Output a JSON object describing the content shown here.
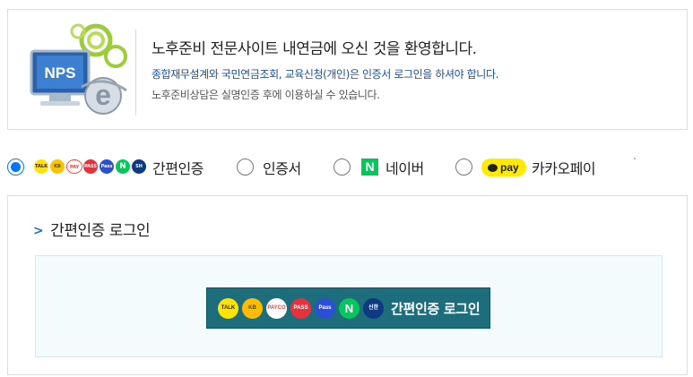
{
  "welcome": {
    "logo_text": "NPS",
    "title": "노후준비 전문사이트 내연금에 오신 것을 환영합니다.",
    "notice": "종합재무설계와 국민연금조회, 교육신청(개인)은 인증서 로그인을 하셔야 합니다.",
    "sub": "노후준비상담은 실명인증 후에 이용하실 수 있습니다."
  },
  "methods": {
    "simple": {
      "label": "간편인증",
      "selected": true
    },
    "cert": {
      "label": "인증서",
      "selected": false
    },
    "naver": {
      "label": "네이버",
      "icon_text": "N",
      "selected": false
    },
    "kakao": {
      "label": "카카오페이",
      "icon_text": "pay",
      "selected": false
    },
    "mini_icons": [
      {
        "name": "kakaotalk-icon",
        "color": "#fee500"
      },
      {
        "name": "kb-icon",
        "color": "#f9c400"
      },
      {
        "name": "payco-icon",
        "color": "#ff3c3c"
      },
      {
        "name": "pass-red-icon",
        "color": "#e8313b"
      },
      {
        "name": "pass-blue-icon",
        "color": "#2b4fd6"
      },
      {
        "name": "naver-icon",
        "color": "#03c75a"
      },
      {
        "name": "shinhan-icon",
        "color": "#0d3a80"
      }
    ],
    "tick_mark": "ˋ"
  },
  "panel": {
    "title": "간편인증 로그인",
    "button": {
      "label": "간편인증 로그인",
      "icons": [
        {
          "name": "kakaotalk-icon",
          "text": "TALK",
          "color": "#fee500",
          "text_color": "#3a1d1d"
        },
        {
          "name": "kb-icon",
          "text": "KB",
          "color": "#ffbc00",
          "text_color": "#5a4a00"
        },
        {
          "name": "payco-icon",
          "text": "PAYCO",
          "color": "#ffffff",
          "text_color": "#ff3c3c"
        },
        {
          "name": "pass-red-icon",
          "text": "PASS",
          "color": "#e8313b",
          "text_color": "#ffffff"
        },
        {
          "name": "pass-blue-icon",
          "text": "Pass",
          "color": "#2b4fd6",
          "text_color": "#ffffff"
        },
        {
          "name": "naver-icon",
          "text": "N",
          "color": "#03c75a",
          "text_color": "#ffffff"
        },
        {
          "name": "shinhan-icon",
          "text": "신한",
          "color": "#0d3a80",
          "text_color": "#ffffff"
        }
      ]
    }
  },
  "colors": {
    "accent_blue": "#0075ff",
    "button_teal": "#1d6d7d",
    "notice_blue": "#1f4e9a",
    "inner_bg": "#f3fbfd"
  }
}
